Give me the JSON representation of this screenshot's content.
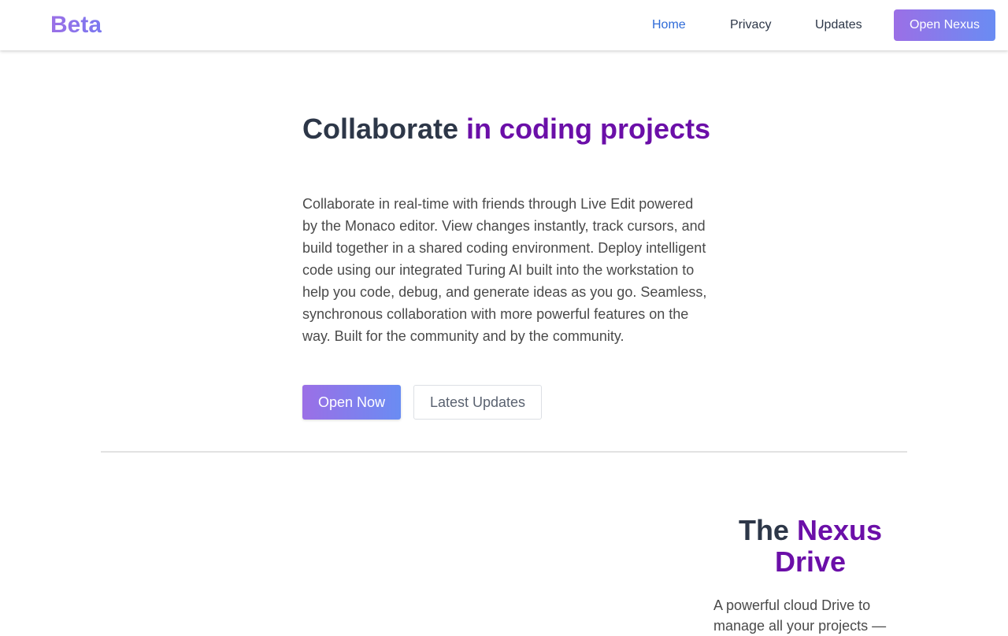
{
  "nav": {
    "brand": "Beta",
    "links": [
      "Home",
      "Privacy",
      "Updates"
    ],
    "cta": "Open Nexus",
    "active_color": "#2f6bd8"
  },
  "hero": {
    "title_plain": "Collaborate ",
    "title_accent": "in coding projects",
    "body": "Collaborate in real-time with friends through Live Edit powered by the Monaco editor. View changes instantly, track cursors, and build together in a shared coding environment. Deploy intelligent code using our integrated Turing AI built into the workstation to help you code, debug, and generate ideas as you go. Seamless, synchronous collaboration with more powerful features on the way. Built for the community and by the community.",
    "primary_button": "Open Now",
    "secondary_button": "Latest Updates"
  },
  "drive": {
    "title_plain": "The ",
    "title_accent": "Nexus Drive",
    "body": "A powerful cloud Drive to manage all your projects —"
  },
  "colors": {
    "accent": "#6b0fa8",
    "gradient_start": "#9b6fe6",
    "gradient_end": "#6a8cf3",
    "heading": "#2d3748"
  }
}
